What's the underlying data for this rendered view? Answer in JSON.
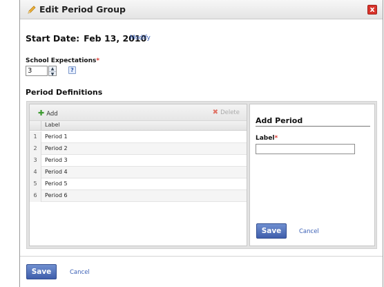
{
  "dialog": {
    "title": "Edit Period Group",
    "close_label": "x"
  },
  "start_date": {
    "label": "Start Date:",
    "value": "Feb 13, 2010",
    "modify_link": "Modify"
  },
  "school_expectations": {
    "label": "School Expectations",
    "required_mark": "*",
    "value": "3",
    "help_label": "?"
  },
  "period_definitions": {
    "title": "Period Definitions",
    "toolbar": {
      "add_label": "Add",
      "delete_label": "Delete"
    },
    "column_header": "Label",
    "rows": [
      {
        "num": "1",
        "label": "Period 1"
      },
      {
        "num": "2",
        "label": "Period 2"
      },
      {
        "num": "3",
        "label": "Period 3"
      },
      {
        "num": "4",
        "label": "Period 4"
      },
      {
        "num": "5",
        "label": "Period 5"
      },
      {
        "num": "6",
        "label": "Period 6"
      }
    ]
  },
  "add_period": {
    "title": "Add Period",
    "label_field": "Label",
    "required_mark": "*",
    "label_value": "",
    "save_label": "Save",
    "cancel_label": "Cancel"
  },
  "footer": {
    "save_label": "Save",
    "cancel_label": "Cancel"
  },
  "colors": {
    "accent": "#3f5eab",
    "link": "#3a5fb5",
    "required": "#d9332b",
    "add_icon": "#3b9a2e"
  }
}
